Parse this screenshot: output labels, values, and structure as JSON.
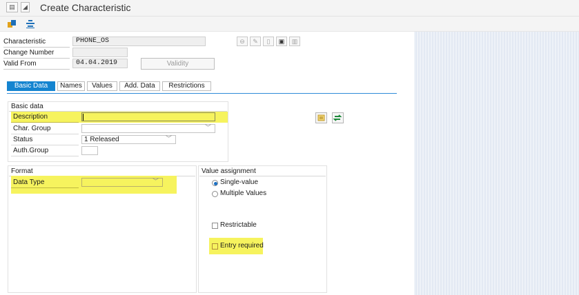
{
  "window": {
    "title": "Create Characteristic"
  },
  "header": {
    "characteristic_label": "Characteristic",
    "characteristic_value": "PHONE_OS",
    "change_number_label": "Change Number",
    "change_number_value": "",
    "valid_from_label": "Valid From",
    "valid_from_value": "04.04.2019",
    "validity_button": "Validity"
  },
  "tabs": [
    "Basic Data",
    "Names",
    "Values",
    "Add. Data",
    "Restrictions"
  ],
  "basic_data": {
    "title": "Basic data",
    "description_label": "Description",
    "description_value": "",
    "char_group_label": "Char. Group",
    "char_group_value": "",
    "status_label": "Status",
    "status_value": "1 Released",
    "auth_group_label": "Auth.Group",
    "auth_group_value": ""
  },
  "format": {
    "title": "Format",
    "data_type_label": "Data Type",
    "data_type_value": ""
  },
  "value_assignment": {
    "title": "Value assignment",
    "single_value": "Single-value",
    "multiple_values": "Multiple Values",
    "selected": "Single-value",
    "restrictable": "Restrictable",
    "entry_required": "Entry required"
  },
  "colors": {
    "highlight": "#f6f35e",
    "tab_active": "#1484d0"
  }
}
